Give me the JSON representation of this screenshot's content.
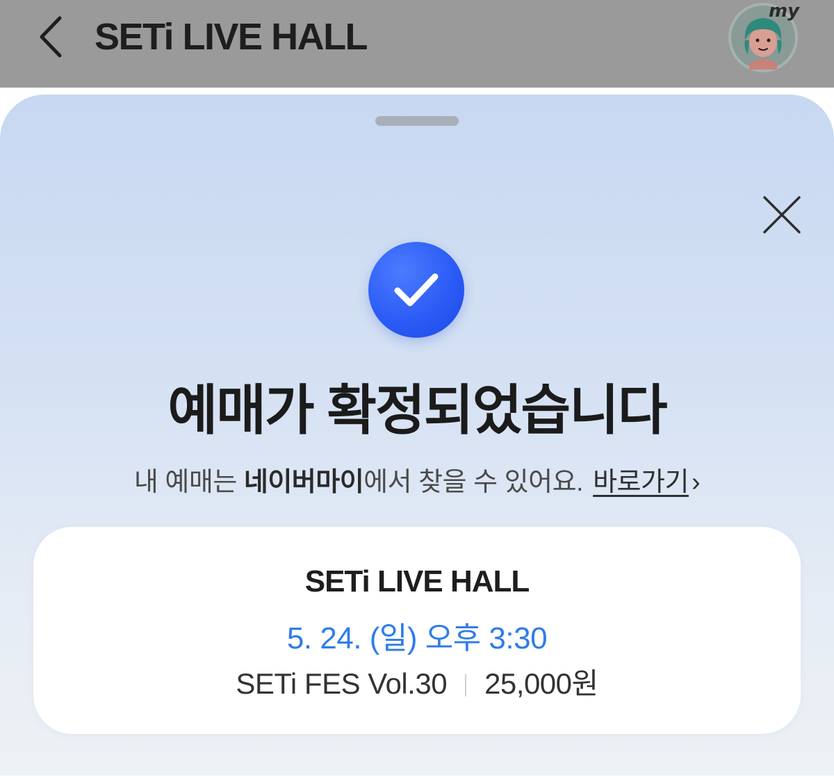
{
  "header": {
    "title": "SETi LIVE HALL",
    "back_icon": "chevron-left-icon",
    "avatar_label": "my"
  },
  "sheet": {
    "title": "예매가 확정되었습니다",
    "subtitle_prefix": "내 예매는 ",
    "subtitle_strong": "네이버마이",
    "subtitle_suffix": "에서 찾을 수 있어요.",
    "link_label": "바로가기",
    "link_chevron": "›",
    "close_icon": "close-icon",
    "badge_icon": "check-icon",
    "badge_color": "#2b5cf6"
  },
  "ticket": {
    "venue": "SETi LIVE HALL",
    "datetime": "5. 24. (일) 오후 3:30",
    "datetime_color": "#2f7de8",
    "event": "SETi FES Vol.30",
    "price": "25,000원"
  }
}
